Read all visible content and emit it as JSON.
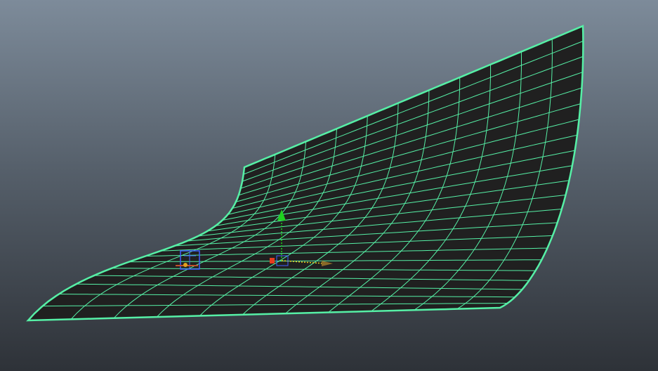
{
  "viewport": {
    "background_top": "#7d8b9a",
    "background_bottom": "#2e3238",
    "surface_fill": "#202020",
    "wireframe_color": "#56f0a6",
    "selected": true
  },
  "scene_objects": [
    {
      "name": "backdrop-sweep-surface",
      "type": "nurbs-surface"
    },
    {
      "name": "camera-locator",
      "type": "locator-icon"
    },
    {
      "name": "move-manipulator",
      "type": "transform-gizmo"
    }
  ],
  "manipulator": {
    "y_axis_color": "#1fd21f",
    "x_axis_color": "#e63c1e",
    "z_axis_color": "#3f5fff",
    "center_color": "#f2d21e"
  }
}
